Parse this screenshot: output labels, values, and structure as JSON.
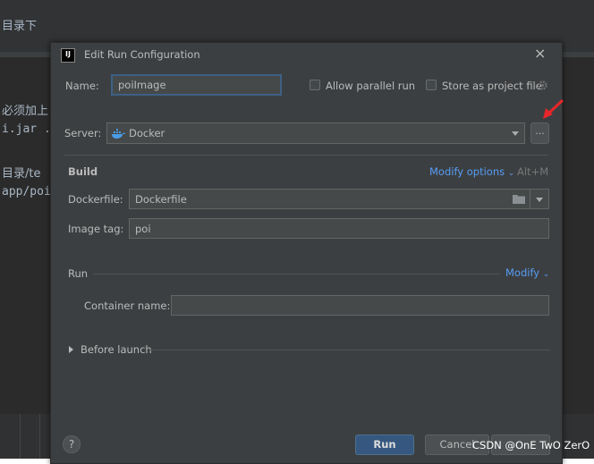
{
  "background": {
    "line1": "目录下",
    "line2": "必须加上",
    "line3": "i.jar .",
    "line4": "目录/te",
    "line5": "app/poi"
  },
  "dialog": {
    "title": "Edit Run Configuration",
    "app_icon_text": "IJ",
    "close_icon": "×",
    "name_label": "Name:",
    "name_value": "poiImage",
    "allow_parallel_label": "Allow parallel run",
    "store_project_label": "Store as project file",
    "server_label": "Server:",
    "server_value": "Docker",
    "server_browse_label": "...",
    "build_heading": "Build",
    "modify_options_link": "Modify options",
    "modify_options_shortcut": "Alt+M",
    "dockerfile_label": "Dockerfile:",
    "dockerfile_value": "Dockerfile",
    "image_tag_label": "Image tag:",
    "image_tag_value": "poi",
    "run_heading": "Run",
    "modify_link": "Modify",
    "container_name_label": "Container name:",
    "container_name_value": "",
    "before_launch_label": "Before launch",
    "help_label": "?",
    "run_button": "Run",
    "cancel_button": "Cancel"
  },
  "watermark": "CSDN @OnE TwO ZerO",
  "colors": {
    "dialog_bg": "#3c3f41",
    "link": "#589df6",
    "primary_button": "#365880",
    "annotation_arrow": "#e8262a"
  }
}
